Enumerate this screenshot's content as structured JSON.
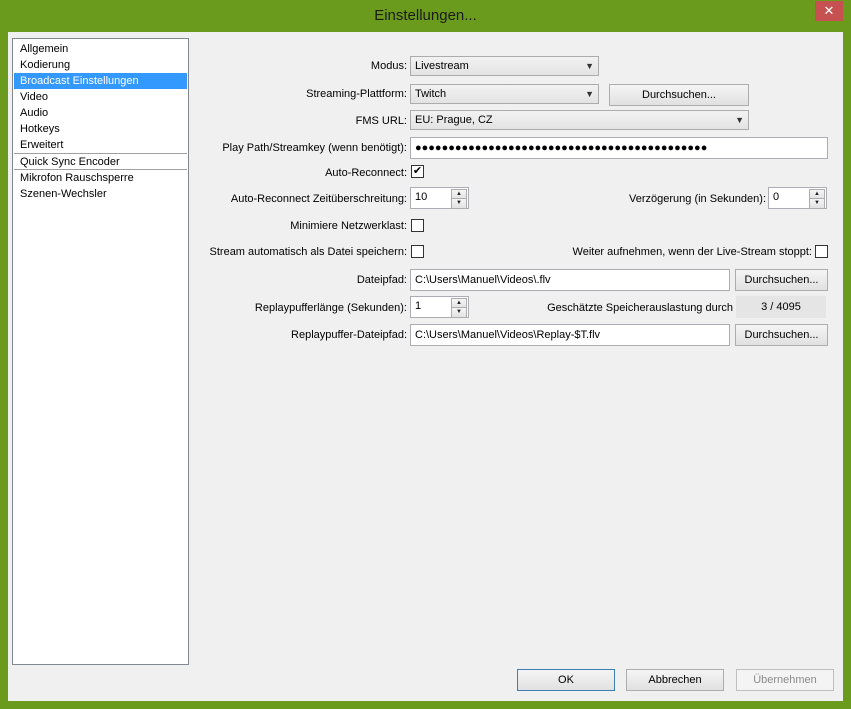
{
  "window": {
    "title": "Einstellungen...",
    "close_glyph": "✕"
  },
  "nav": {
    "items": [
      {
        "label": "Allgemein"
      },
      {
        "label": "Kodierung"
      },
      {
        "label": "Broadcast Einstellungen"
      },
      {
        "label": "Video"
      },
      {
        "label": "Audio"
      },
      {
        "label": "Hotkeys"
      },
      {
        "label": "Erweitert"
      },
      {
        "label": "Quick Sync Encoder"
      },
      {
        "label": "Mikrofon Rauschsperre"
      },
      {
        "label": "Szenen-Wechsler"
      }
    ],
    "selected": "Broadcast Einstellungen"
  },
  "form": {
    "mode": {
      "label": "Modus:",
      "value": "Livestream"
    },
    "platform": {
      "label": "Streaming-Plattform:",
      "value": "Twitch",
      "browse": "Durchsuchen..."
    },
    "fms_url": {
      "label": "FMS URL:",
      "value": "EU: Prague, CZ"
    },
    "streamkey": {
      "label": "Play Path/Streamkey (wenn benötigt):",
      "value": "●●●●●●●●●●●●●●●●●●●●●●●●●●●●●●●●●●●●●●●●●●●●"
    },
    "auto_reconnect": {
      "label": "Auto-Reconnect:",
      "checked": true,
      "check_glyph": "✔"
    },
    "reconnect_timeout": {
      "label": "Auto-Reconnect Zeitüberschreitung:",
      "value": "10"
    },
    "delay": {
      "label": "Verzögerung (in Sekunden):",
      "value": "0"
    },
    "minimize_net": {
      "label": "Minimiere Netzwerklast:",
      "checked": false
    },
    "save_to_file": {
      "label": "Stream automatisch als Datei speichern:",
      "checked": false
    },
    "keep_recording": {
      "label": "Weiter aufnehmen, wenn der Live-Stream stoppt:",
      "checked": false
    },
    "file_path": {
      "label": "Dateipfad:",
      "value": "C:\\Users\\Manuel\\Videos\\.flv",
      "browse": "Durchsuchen..."
    },
    "replay_length": {
      "label": "Replaypufferlänge (Sekunden):",
      "value": "1"
    },
    "memory_usage": {
      "label": "Geschätzte Speicherauslastung durch",
      "value": "3 / 4095"
    },
    "replay_path": {
      "label": "Replaypuffer-Dateipfad:",
      "value": "C:\\Users\\Manuel\\Videos\\Replay-$T.flv",
      "browse": "Durchsuchen..."
    }
  },
  "footer": {
    "ok": "OK",
    "cancel": "Abbrechen",
    "apply": "Übernehmen"
  },
  "icons": {
    "dropdown": "chevron-down-icon",
    "spin_up": "▲",
    "spin_down": "▼"
  }
}
